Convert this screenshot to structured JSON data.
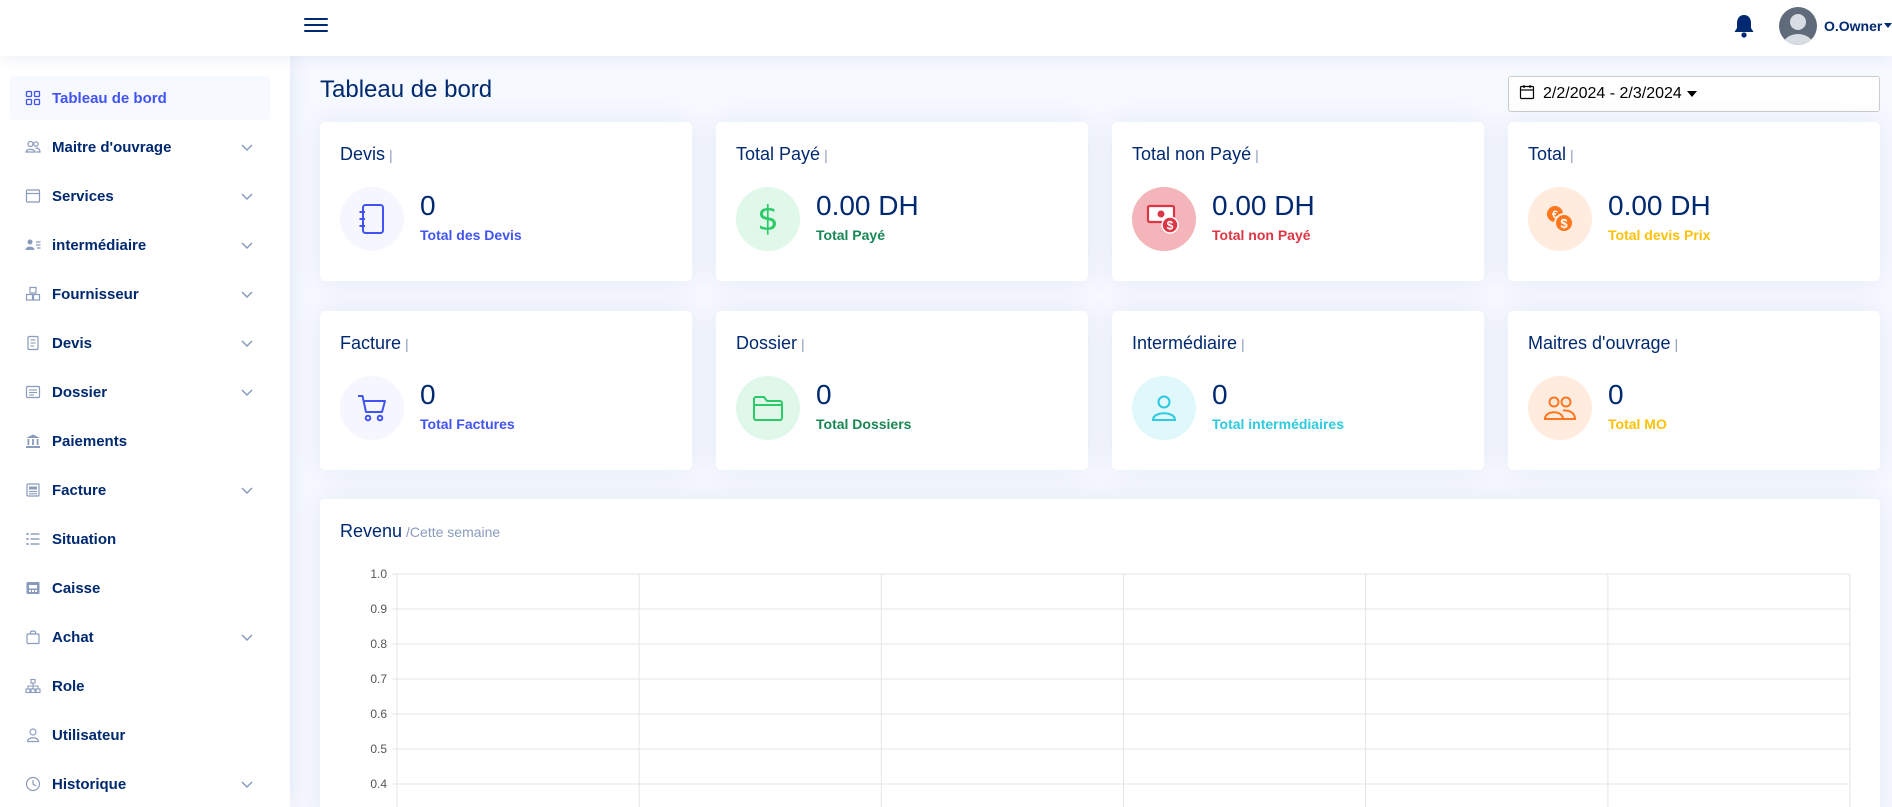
{
  "header": {
    "menu_icon": "hamburger-icon",
    "notification_icon": "bell-icon",
    "user_name": "O.Owner"
  },
  "sidebar": {
    "items": [
      {
        "label": "Tableau de bord",
        "icon": "grid-icon",
        "active": true,
        "expandable": false
      },
      {
        "label": "Maitre d'ouvrage",
        "icon": "users-icon",
        "active": false,
        "expandable": true
      },
      {
        "label": "Services",
        "icon": "window-icon",
        "active": false,
        "expandable": true
      },
      {
        "label": "intermédiaire",
        "icon": "person-lines-icon",
        "active": false,
        "expandable": true
      },
      {
        "label": "Fournisseur",
        "icon": "boxes-icon",
        "active": false,
        "expandable": true
      },
      {
        "label": "Devis",
        "icon": "document-icon",
        "active": false,
        "expandable": true
      },
      {
        "label": "Dossier",
        "icon": "card-text-icon",
        "active": false,
        "expandable": true
      },
      {
        "label": "Paiements",
        "icon": "bank-icon",
        "active": false,
        "expandable": false
      },
      {
        "label": "Facture",
        "icon": "newspaper-icon",
        "active": false,
        "expandable": true
      },
      {
        "label": "Situation",
        "icon": "list-icon",
        "active": false,
        "expandable": false
      },
      {
        "label": "Caisse",
        "icon": "cash-register-icon",
        "active": false,
        "expandable": false
      },
      {
        "label": "Achat",
        "icon": "bag-icon",
        "active": false,
        "expandable": true
      },
      {
        "label": "Role",
        "icon": "diagram-icon",
        "active": false,
        "expandable": false
      },
      {
        "label": "Utilisateur",
        "icon": "person-icon",
        "active": false,
        "expandable": false
      },
      {
        "label": "Historique",
        "icon": "clock-icon",
        "active": false,
        "expandable": true
      }
    ]
  },
  "main": {
    "page_title": "Tableau de bord",
    "date_range": "2/2/2024 - 2/3/2024"
  },
  "cards": [
    {
      "title": "Devis",
      "pipe": "|",
      "value": "0",
      "subtitle": "Total des Devis",
      "icon": "journal-icon",
      "accent": "#4154f1",
      "icon_bg": "#f6f6fe"
    },
    {
      "title": "Total Payé",
      "pipe": "|",
      "value": "0.00 DH",
      "subtitle": "Total Payé",
      "icon": "dollar-icon",
      "accent": "#198754",
      "icon_bg": "#e0f8e9"
    },
    {
      "title": "Total non Payé",
      "pipe": "|",
      "value": "0.00 DH",
      "subtitle": "Total non Payé",
      "icon": "money-bill-icon",
      "accent": "#dc3545",
      "icon_bg": "#f3b5b9"
    },
    {
      "title": "Total",
      "pipe": "|",
      "value": "0.00 DH",
      "subtitle": "Total devis Prix",
      "icon": "coins-icon",
      "accent": "#ffc107",
      "icon_bg": "#ffecdf"
    },
    {
      "title": "Facture",
      "pipe": "|",
      "value": "0",
      "subtitle": "Total Factures",
      "icon": "cart-icon",
      "accent": "#4154f1",
      "icon_bg": "#f6f6fe"
    },
    {
      "title": "Dossier",
      "pipe": "|",
      "value": "0",
      "subtitle": "Total Dossiers",
      "icon": "folder-icon",
      "accent": "#198754",
      "icon_bg": "#e0f8e9"
    },
    {
      "title": "Intermédiaire",
      "pipe": "|",
      "value": "0",
      "subtitle": "Total intermédiaires",
      "icon": "person-icon",
      "accent": "#2eca9f",
      "icon_bg": "#e0f8fb"
    },
    {
      "title": "Maitres d'ouvrage",
      "pipe": "|",
      "value": "0",
      "subtitle": "Total MO",
      "icon": "people-icon",
      "accent": "#ffc107",
      "icon_bg": "#ffecdf"
    }
  ],
  "revenue": {
    "title": "Revenu",
    "subtitle": "/Cette semaine"
  },
  "chart_data": {
    "type": "line",
    "title": "Revenu",
    "subtitle": "/Cette semaine",
    "y_ticks": [
      "1.0",
      "0.9",
      "0.8",
      "0.7",
      "0.6",
      "0.5",
      "0.4"
    ],
    "ylim": [
      0,
      1.0
    ],
    "x_gridlines": 6,
    "grid": true,
    "series": []
  },
  "colors": {
    "primary": "#4154f1",
    "navy": "#012970",
    "success": "#198754",
    "danger": "#dc3545",
    "warning": "#ffc107",
    "info": "#2eca9f"
  }
}
